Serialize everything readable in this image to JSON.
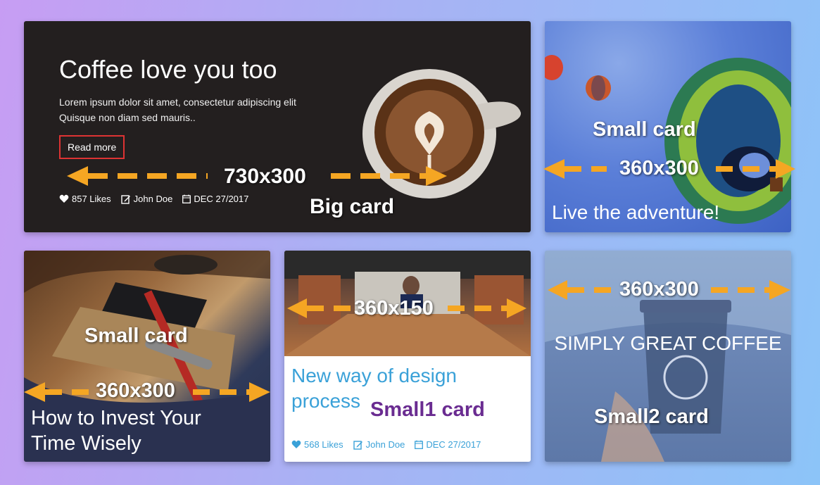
{
  "big_card": {
    "title": "Coffee love you too",
    "description": "Lorem ipsum dolor sit amet, consectetur adipiscing elit Quisque non diam sed mauris..",
    "read_more": "Read more",
    "likes": "857 Likes",
    "author": "John Doe",
    "date": "DEC 27/2017"
  },
  "balloon_card": {
    "title": "Live the adventure!"
  },
  "notebook_card": {
    "title": "How to Invest Your Time Wisely"
  },
  "design_card": {
    "title": "New way of design process",
    "likes": "568 Likes",
    "author": "John Doe",
    "date": "DEC 27/2017"
  },
  "coffee_card": {
    "title": "SIMPLY GREAT COFFEE"
  },
  "annotations": {
    "big_size": "730x300",
    "big_label": "Big card",
    "small_size_1": "360x300",
    "small_label_1": "Small card",
    "small_size_2": "360x300",
    "small_label_2": "Small card",
    "small1_size": "360x150",
    "small1_label": "Small1 card",
    "small2_size": "360x300",
    "small2_label": "Small2 card"
  },
  "icons": {
    "heart": "heart-icon",
    "edit": "edit-icon",
    "calendar": "calendar-icon"
  },
  "colors": {
    "big_bg": "#231f1f",
    "read_more_border": "#dd3333",
    "design_accent": "#3aa1d8",
    "arrow": "#f5a623",
    "small1_label": "#6a2c91"
  }
}
